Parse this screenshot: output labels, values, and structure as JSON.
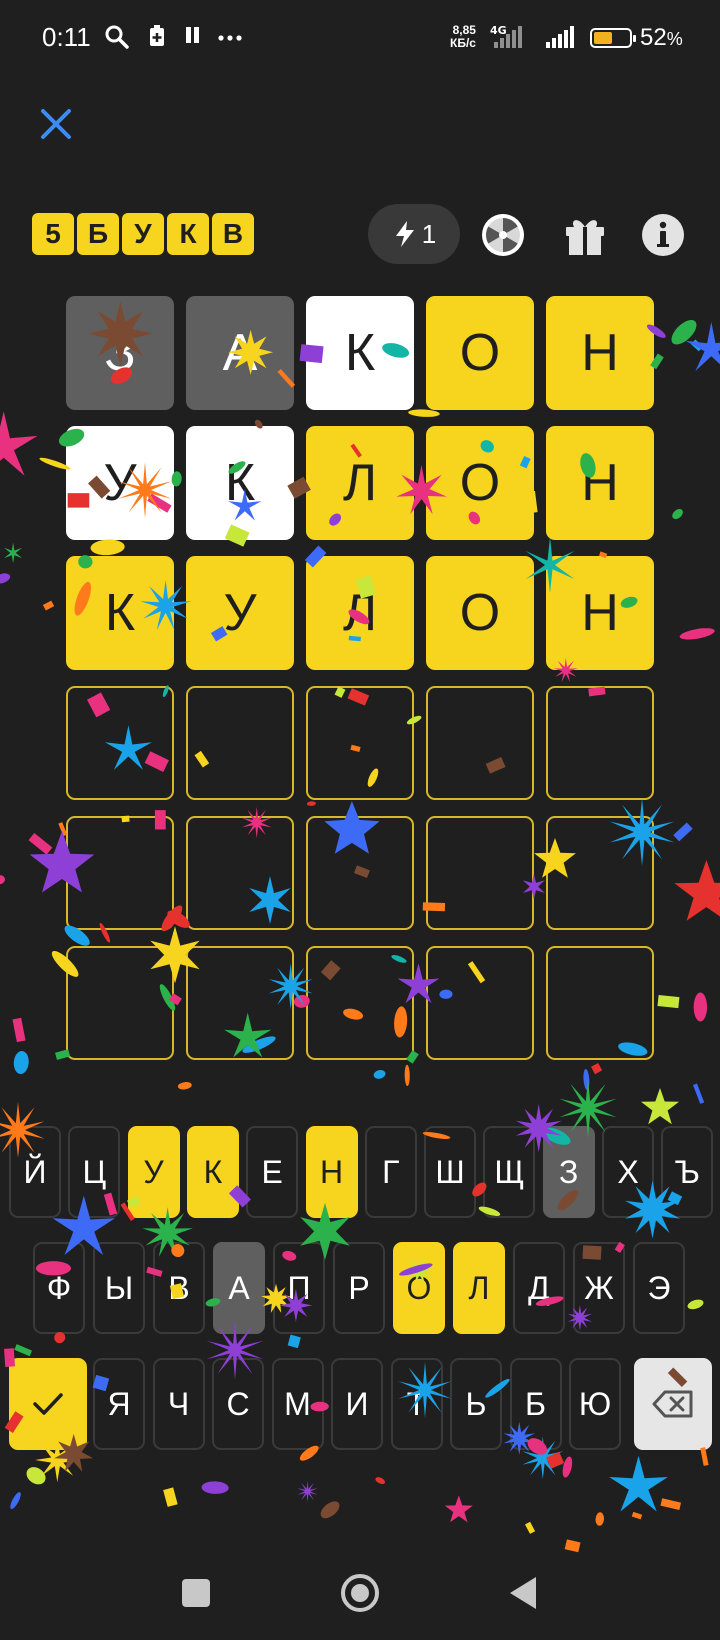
{
  "status": {
    "time": "0:11",
    "speed_value": "8,85",
    "speed_unit": "КБ/с",
    "network": "4G",
    "battery_percent": "52",
    "battery_suffix": "%",
    "battery_level": 0.52,
    "icons": [
      "search-icon",
      "battery-saver-icon",
      "pause-icon",
      "more-icon"
    ]
  },
  "header": {
    "logo_letters": [
      "5",
      "Б",
      "У",
      "К",
      "В"
    ],
    "hint_count": "1",
    "icons": [
      "close-icon",
      "lightning-icon",
      "wheel-icon",
      "gift-icon",
      "info-icon"
    ]
  },
  "board": {
    "rows": [
      [
        {
          "l": "З",
          "s": "gray"
        },
        {
          "l": "А",
          "s": "gray"
        },
        {
          "l": "К",
          "s": "white"
        },
        {
          "l": "О",
          "s": "yellow"
        },
        {
          "l": "Н",
          "s": "yellow"
        }
      ],
      [
        {
          "l": "У",
          "s": "white"
        },
        {
          "l": "К",
          "s": "white"
        },
        {
          "l": "Л",
          "s": "yellow"
        },
        {
          "l": "О",
          "s": "yellow"
        },
        {
          "l": "Н",
          "s": "yellow"
        }
      ],
      [
        {
          "l": "К",
          "s": "yellow"
        },
        {
          "l": "У",
          "s": "yellow"
        },
        {
          "l": "Л",
          "s": "yellow"
        },
        {
          "l": "О",
          "s": "yellow"
        },
        {
          "l": "Н",
          "s": "yellow"
        }
      ],
      [
        {
          "l": "",
          "s": "empty"
        },
        {
          "l": "",
          "s": "empty"
        },
        {
          "l": "",
          "s": "empty"
        },
        {
          "l": "",
          "s": "empty"
        },
        {
          "l": "",
          "s": "empty"
        }
      ],
      [
        {
          "l": "",
          "s": "empty"
        },
        {
          "l": "",
          "s": "empty"
        },
        {
          "l": "",
          "s": "empty"
        },
        {
          "l": "",
          "s": "empty"
        },
        {
          "l": "",
          "s": "empty"
        }
      ],
      [
        {
          "l": "",
          "s": "empty"
        },
        {
          "l": "",
          "s": "empty"
        },
        {
          "l": "",
          "s": "empty"
        },
        {
          "l": "",
          "s": "empty"
        },
        {
          "l": "",
          "s": "empty"
        }
      ]
    ]
  },
  "keyboard": {
    "row1": [
      {
        "k": "Й",
        "s": "none"
      },
      {
        "k": "Ц",
        "s": "none"
      },
      {
        "k": "У",
        "s": "yellow"
      },
      {
        "k": "К",
        "s": "yellow"
      },
      {
        "k": "Е",
        "s": "none"
      },
      {
        "k": "Н",
        "s": "yellow"
      },
      {
        "k": "Г",
        "s": "none"
      },
      {
        "k": "Ш",
        "s": "none"
      },
      {
        "k": "Щ",
        "s": "none"
      },
      {
        "k": "З",
        "s": "gray"
      },
      {
        "k": "Х",
        "s": "none"
      },
      {
        "k": "Ъ",
        "s": "none"
      }
    ],
    "row2": [
      {
        "k": "Ф",
        "s": "none"
      },
      {
        "k": "Ы",
        "s": "none"
      },
      {
        "k": "В",
        "s": "none"
      },
      {
        "k": "А",
        "s": "gray"
      },
      {
        "k": "П",
        "s": "none"
      },
      {
        "k": "Р",
        "s": "none"
      },
      {
        "k": "О",
        "s": "yellow"
      },
      {
        "k": "Л",
        "s": "yellow"
      },
      {
        "k": "Д",
        "s": "none"
      },
      {
        "k": "Ж",
        "s": "none"
      },
      {
        "k": "Э",
        "s": "none"
      }
    ],
    "row3": [
      {
        "k": "Я",
        "s": "none"
      },
      {
        "k": "Ч",
        "s": "none"
      },
      {
        "k": "С",
        "s": "none"
      },
      {
        "k": "М",
        "s": "none"
      },
      {
        "k": "И",
        "s": "none"
      },
      {
        "k": "Т",
        "s": "none"
      },
      {
        "k": "Ь",
        "s": "none"
      },
      {
        "k": "Б",
        "s": "none"
      },
      {
        "k": "Ю",
        "s": "none"
      }
    ],
    "enter_icon": "check-icon",
    "backspace_icon": "backspace-icon"
  },
  "colors": {
    "background": "#1f1f1f",
    "yellow": "#f7d41d",
    "gray": "#5f5f5f",
    "white": "#ffffff",
    "empty_border": "#d6b82a",
    "accent_blue": "#3d8bf5"
  },
  "nav": {
    "icons": [
      "recents-icon",
      "home-icon",
      "back-icon"
    ]
  }
}
